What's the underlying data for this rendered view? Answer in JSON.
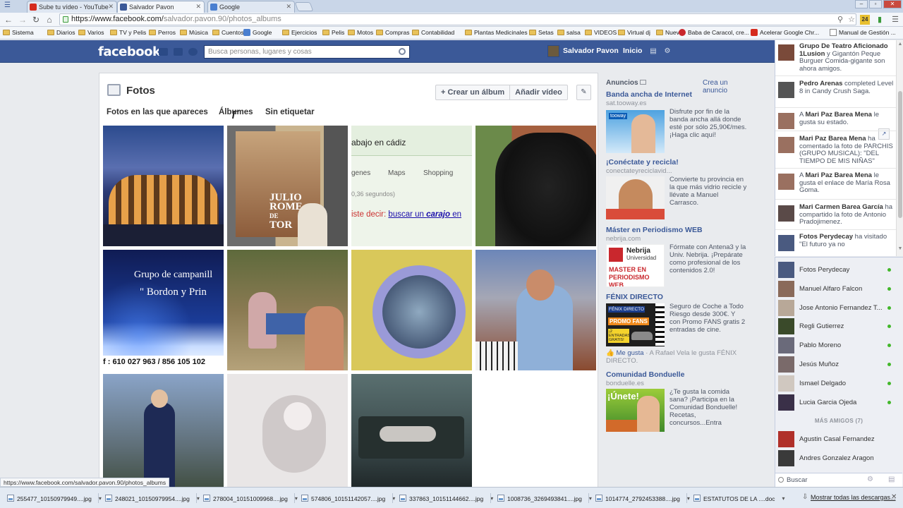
{
  "browser": {
    "tabs": [
      {
        "label": "Sube tu vídeo - YouTube",
        "fav": "#d52b1e"
      },
      {
        "label": "Salvador Pavon",
        "fav": "#3b5998"
      },
      {
        "label": "Google",
        "fav": "#4a7fd0"
      }
    ],
    "url_host": "https://www.facebook.com/",
    "url_path": "salvador.pavon.90/photos_albums",
    "bookmarks": [
      "Sistema",
      "Diarios",
      "Varios",
      "TV y Pelis",
      "Perros",
      "Música",
      "Cuentos",
      "Google",
      "Ejercicios",
      "Pelis",
      "Motos",
      "Compras",
      "Contabilidad",
      "Plantas Medicinales",
      "Setas",
      "salsa",
      "VIDEOS",
      "Virtual dj",
      "Nueva",
      "Baba de Caracol, cre...",
      "Acelerar Google Chr...",
      "Manual de Gestión ..."
    ],
    "status_url": "https://www.facebook.com/salvador.pavon.90/photos_albums",
    "ext_badge": "24"
  },
  "fb": {
    "logo": "facebook",
    "search_placeholder": "Busca personas, lugares y cosas",
    "user_name": "Salvador Pavon",
    "home": "Inicio"
  },
  "photos": {
    "title": "Fotos",
    "create_album": "+ Crear un álbum",
    "add_video": "Añadir vídeo",
    "tabs": [
      "Fotos en las que apareces",
      "Álbumes",
      "Sin etiquetar"
    ],
    "captions": {
      "search_snippet": "abajo en cádiz",
      "search_tabs": [
        "genes",
        "Maps",
        "Shopping"
      ],
      "search_time": "0,36 segundos)",
      "search_didyoumean": "iste decir: ",
      "search_link_a": "buscar un ",
      "search_link_b": "carajo",
      "search_link_c": " en",
      "poster_1": "JULIO",
      "poster_2": "ROME",
      "poster_3": "DE",
      "poster_4": "TOR",
      "bell_1": "Grupo de campanill",
      "bell_2": "\" Bordon y Prin",
      "bell_tel": "f : 610 027 963 / 856 105 102"
    }
  },
  "ads": {
    "header": "Anuncios",
    "create": "Crea un anuncio",
    "items": [
      {
        "title": "Banda ancha de Internet",
        "url": "sat.tooway.es",
        "body": "Disfrute por fin de la banda ancha allá donde esté por sólo 25,90€/mes. ¡Haga clic aquí!"
      },
      {
        "title": "¡Conéctate y recicla!",
        "url": "conectateyreciclavid...",
        "body": "Convierte tu provincia en la que más vidrio recicle y llévate a Manuel Carrasco."
      },
      {
        "title": "Máster en Periodismo WEB",
        "url": "nebrija.com",
        "body": "Fórmate con Antena3 y la Univ. Nebrija. ¡Prepárate como profesional de los contenidos 2.0!"
      },
      {
        "title": "FÉNIX DIRECTO",
        "url": "",
        "body": "Seguro de Coche a Todo Riesgo desde 300€. Y con Promo FANS gratis 2 entradas de cine."
      },
      {
        "title": "Comunidad Bonduelle",
        "url": "bonduelle.es",
        "body": "¿Te gusta la comida sana? ¡Participa en la Comunidad Bonduelle! Recetas, concursos...Entra"
      }
    ],
    "fenix_like_a": "Me gusta",
    "fenix_like_b": " · A Rafael Vela le gusta FÉNIX DIRECTO.",
    "nebrija_img_1": "Nebrija",
    "nebrija_img_2": "Universidad",
    "nebrija_img_3": "MASTER EN PERIODISMO WEB",
    "fenix_img_1": "FÉNIX DIRECTO",
    "fenix_img_2": "PROMO FANS",
    "fenix_img_3": "¡2 ENTRADAS GRATIS!",
    "bonduelle_img": "¡Únete!",
    "tooway_img": "tooway"
  },
  "ticker": [
    {
      "bold": "Grupo De Teatro Aficionado 1Lusion",
      "rest": " y Gigantón Peque Burguer Comida-gigante son ahora amigos."
    },
    {
      "bold": "Pedro Arenas",
      "rest": " completed Level 8 in Candy Crush Saga."
    },
    {
      "bold": "",
      "rest": "A ",
      "bold2": "Mari Paz Barea Mena",
      "rest2": " le gusta su estado."
    },
    {
      "bold": "Mari Paz Barea Mena",
      "rest": " ha comentado la foto de PARCHIS (GRUPO MUSICAL): \"DEL TIEMPO DE MIS NIÑAS\""
    },
    {
      "bold": "",
      "rest": "A ",
      "bold2": "Mari Paz Barea Mena",
      "rest2": " le gusta el enlace de María Rosa Goma."
    },
    {
      "bold": "Mari Carmen Barea García",
      "rest": " ha compartido la foto de Antonio Pradojimenez."
    },
    {
      "bold": "Fotos Perydecay",
      "rest": " ha visitado \"El futuro ya no"
    }
  ],
  "chat": {
    "online": [
      "Fotos Perydecay",
      "Manuel Alfaro Falcon",
      "Jose Antonio Fernandez T...",
      "Regli Gutierrez",
      "Pablo Moreno",
      "Jesús Muñoz",
      "Ismael Delgado",
      "Lucia Garcia Ojeda"
    ],
    "more_header": "MÁS AMIGOS (7)",
    "more": [
      "Agustin Casal Fernandez",
      "Andres Gonzalez Aragon"
    ],
    "search": "Buscar"
  },
  "downloads": {
    "items": [
      "255477_10150979949....jpg",
      "248021_10150979954....jpg",
      "278004_10151009968....jpg",
      "574806_10151142057....jpg",
      "337863_10151144662....jpg",
      "1008736_3269493841....jpg",
      "1014774_2792453388....jpg",
      "ESTATUTOS DE LA ....doc"
    ],
    "show_all": "Mostrar todas las descargas..."
  }
}
